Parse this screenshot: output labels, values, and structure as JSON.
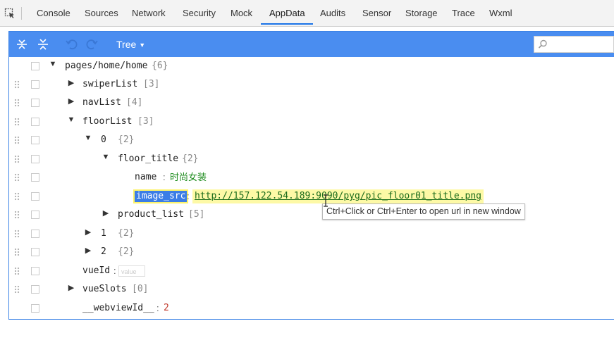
{
  "devtools": {
    "tabs": [
      "Console",
      "Sources",
      "Network",
      "Security",
      "Mock",
      "AppData",
      "Audits",
      "Sensor",
      "Storage",
      "Trace",
      "Wxml"
    ],
    "active_tab": "AppData"
  },
  "toolbar": {
    "mode_label": "Tree",
    "search_placeholder": ""
  },
  "tree": {
    "root_key": "pages/home/home",
    "root_count": "{6}",
    "swiper_key": "swiperList",
    "swiper_count": "[3]",
    "nav_key": "navList",
    "nav_count": "[4]",
    "floor_key": "floorList",
    "floor_count": "[3]",
    "item0_key": "0",
    "item0_count": "{2}",
    "floor_title_key": "floor_title",
    "floor_title_count": "{2}",
    "name_key": "name",
    "name_value": "时尚女装",
    "image_key": "image_src",
    "image_value": "http://157.122.54.189:9090/pyg/pic_floor01_title.png",
    "product_key": "product_list",
    "product_count": "[5]",
    "item1_key": "1",
    "item1_count": "{2}",
    "item2_key": "2",
    "item2_count": "{2}",
    "vueid_key": "vueId",
    "vueid_placeholder": "value",
    "vueslots_key": "vueSlots",
    "vueslots_count": "[0]",
    "webview_key": "__webviewId__",
    "webview_value": "2",
    "colon": ":"
  },
  "tooltip": "Ctrl+Click or Ctrl+Enter to open url in new window",
  "colors": {
    "toolbar_blue": "#4a8df0",
    "selected_key_bg": "#3b7de6",
    "url_highlight": "#fdf9a6",
    "string_value": "#1a8a1a",
    "number_value": "#c0392b"
  }
}
